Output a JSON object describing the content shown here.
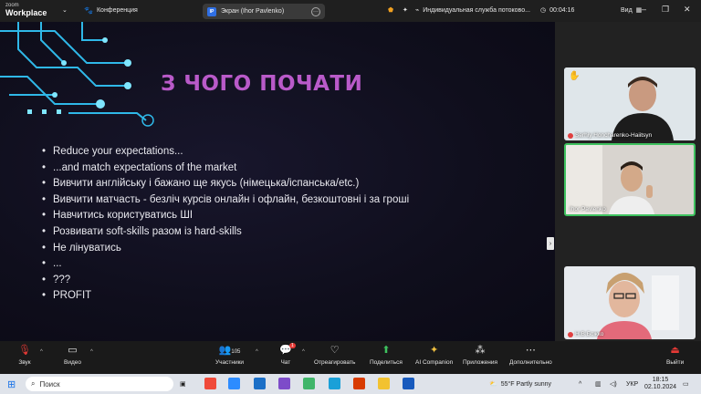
{
  "topbar": {
    "brand_small": "zoom",
    "brand_large": "Workplace",
    "conference_label": "Конференция",
    "screen_badge": "IP",
    "screen_label": "Экран (Ihor Pavlenko)",
    "notification_text": "Индивидуальная служба потоково...",
    "timer": "00:04:16",
    "view_label": "Вид"
  },
  "slide": {
    "title": "З ЧОГО ПОЧАТИ",
    "bullets": [
      "Reduce your expectations...",
      "...and match expectations of the market",
      "Вивчити англійську і бажано ще якусь (німецька/іспанська/etc.)",
      "Вивчити матчасть - безліч курсів онлайн і офлайн, безкоштовні і за гроші",
      "Навчитись користуватись ШІ",
      "Розвивати soft-skills разом із hard-skills",
      "Не лінуватись",
      "...",
      "???",
      "PROFIT"
    ]
  },
  "participants": [
    {
      "name": "Serhiy Honcharenko-Haiitsyn",
      "muted": true,
      "hand_raised": true
    },
    {
      "name": "Ihor Pavlenko",
      "muted": false,
      "hand_raised": false,
      "active": true
    },
    {
      "name": "Н.В.Божко",
      "muted": true,
      "hand_raised": false
    }
  ],
  "toolbar": {
    "audio": "Звук",
    "video": "Видео",
    "participants": "Участники",
    "participants_count": "105",
    "chat": "Чат",
    "chat_badge": "1",
    "react": "Отреагировать",
    "share": "Поделиться",
    "ai": "AI Companion",
    "apps": "Приложения",
    "more": "Дополнительно",
    "leave": "Выйти"
  },
  "taskbar": {
    "search_placeholder": "Поиск",
    "weather": "55°F  Partly sunny",
    "language": "УКР",
    "time": "18:15",
    "date": "02.10.2024"
  },
  "colors": {
    "slide_title": "#b95ac9",
    "circuit": "#2fb8e8",
    "active_speaker_border": "#3ec25f",
    "leave_red": "#e53935"
  }
}
